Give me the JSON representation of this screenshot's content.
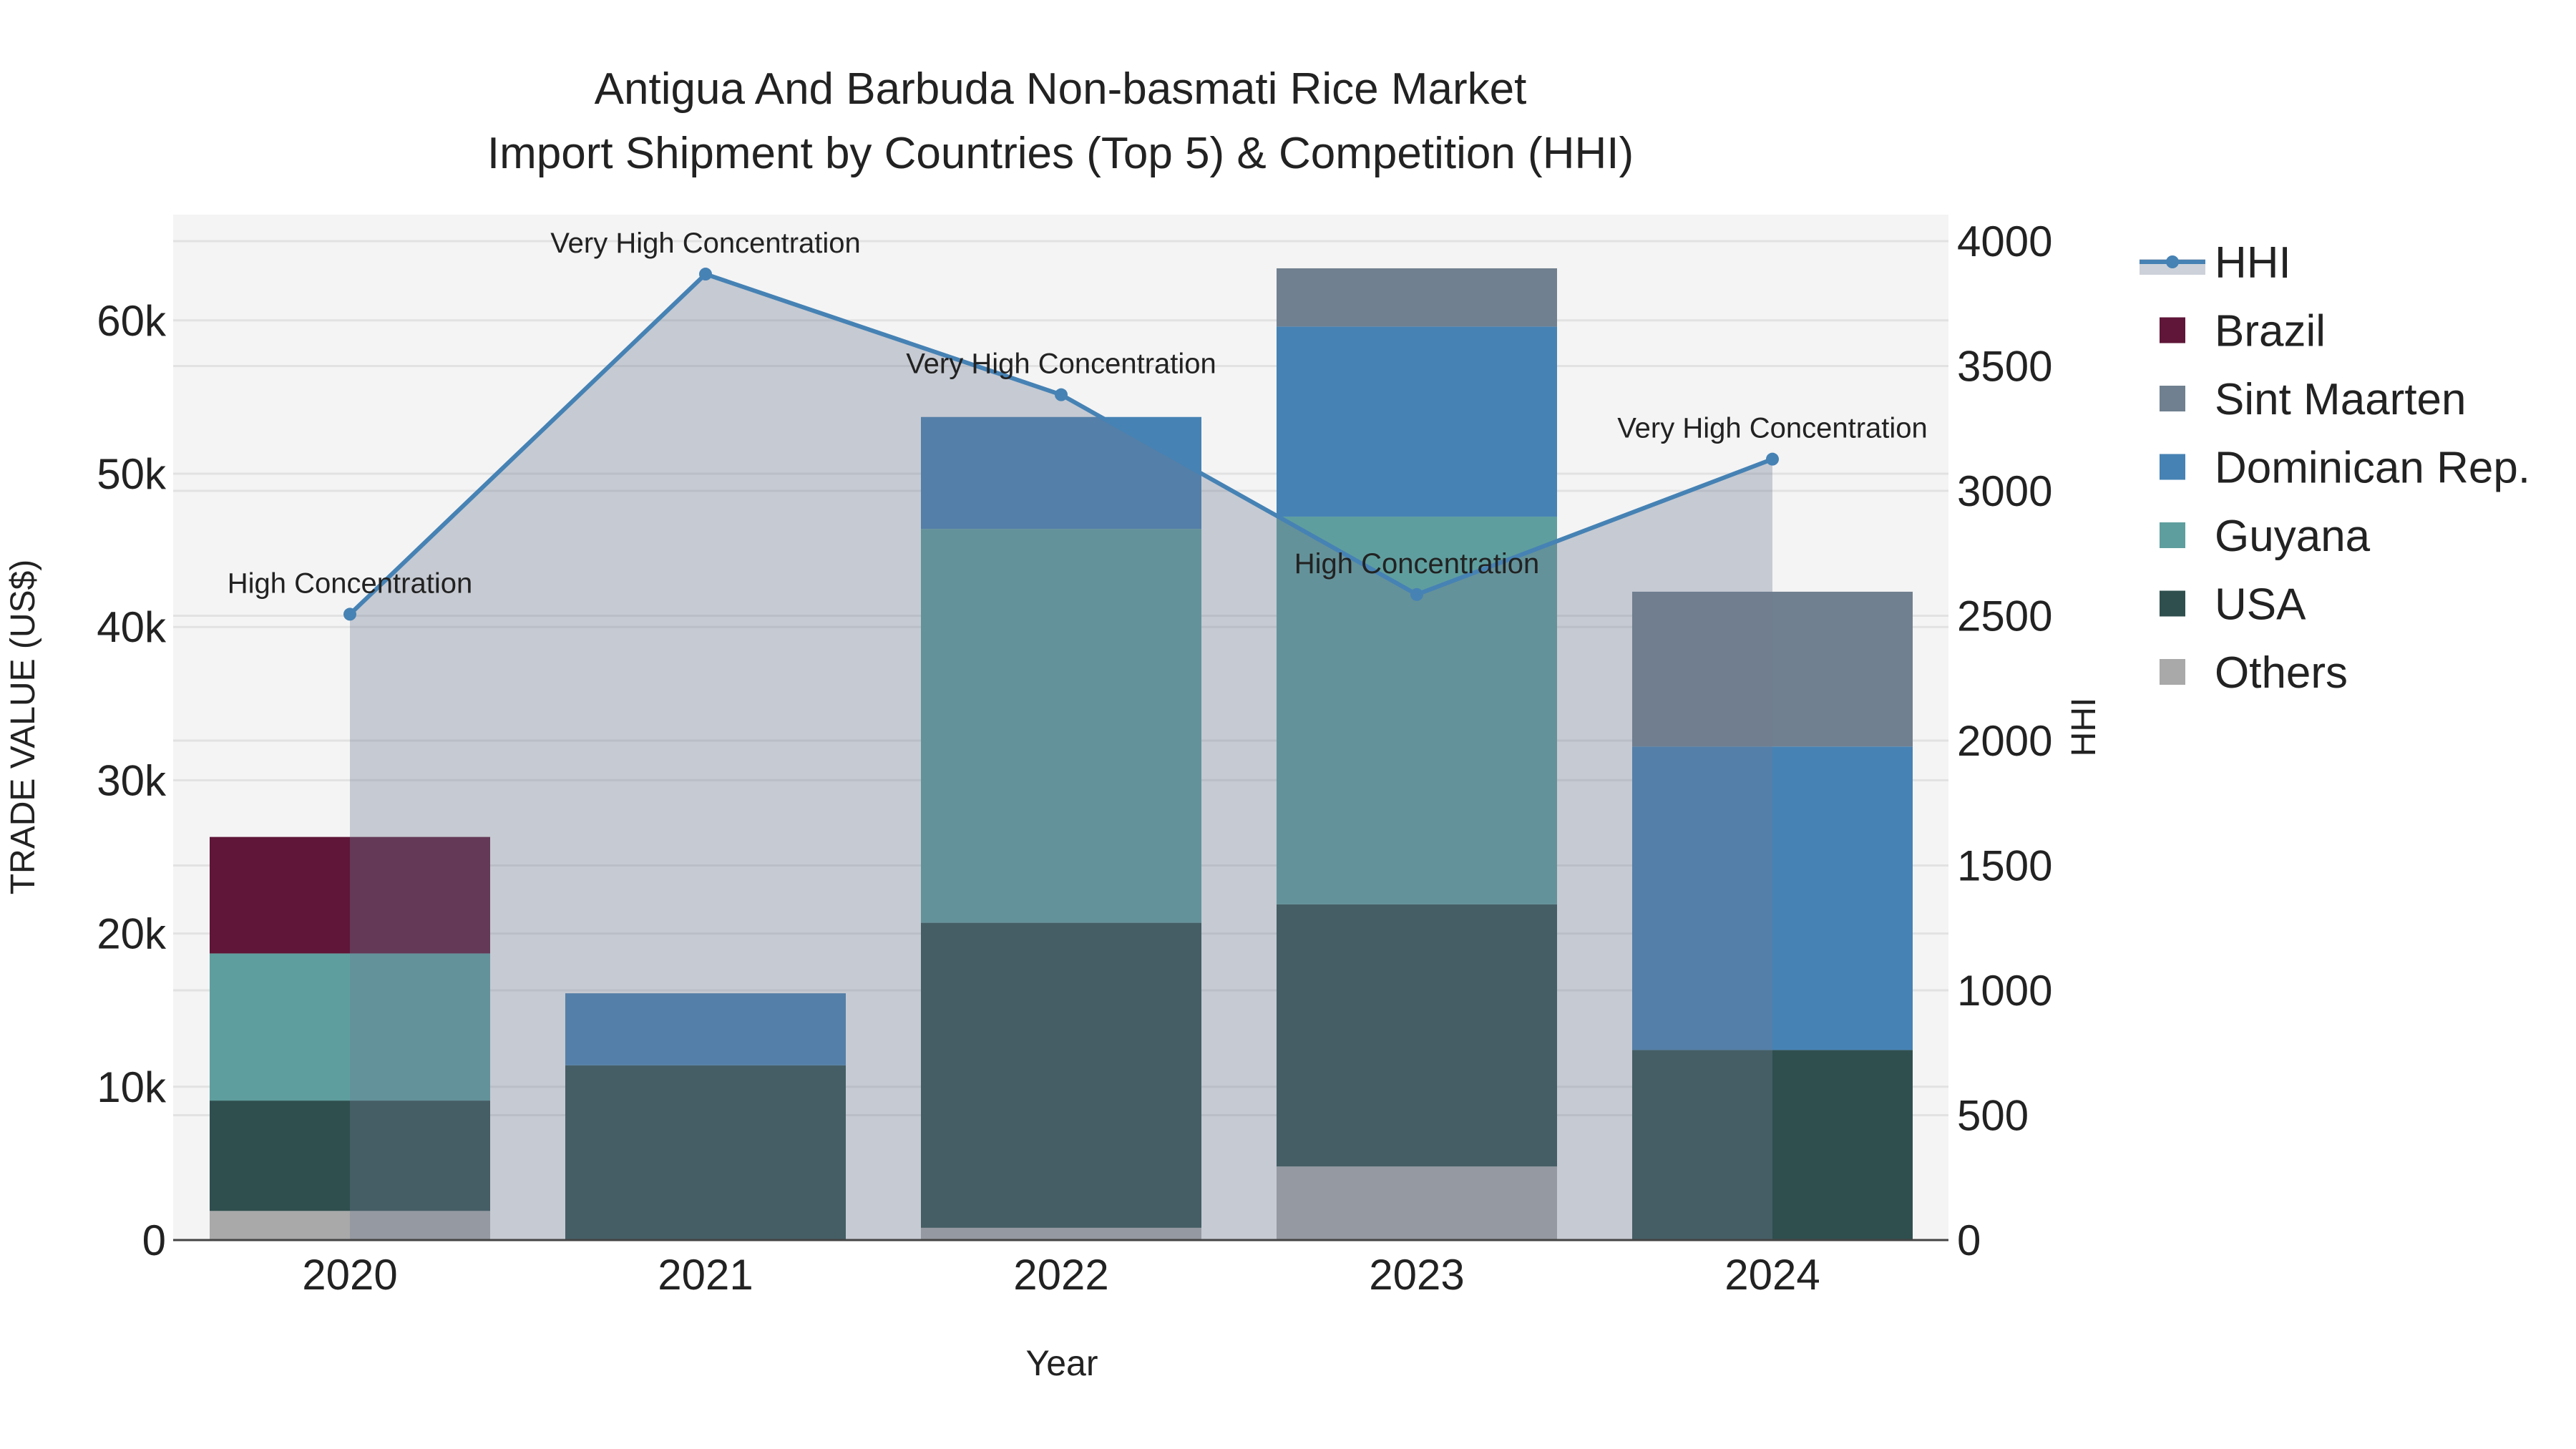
{
  "chart_data": {
    "type": "bar",
    "title_line1": "Antigua And Barbuda Non-basmati Rice Market",
    "title_line2": "Import Shipment by Countries (Top 5) & Competition (HHI)",
    "xlabel": "Year",
    "ylabel": "TRADE VALUE (US$)",
    "y2label": "HHI",
    "categories": [
      "2020",
      "2021",
      "2022",
      "2023",
      "2024"
    ],
    "ylim": [
      0,
      66900
    ],
    "y2lim": [
      0,
      4106
    ],
    "yticks": [
      0,
      10000,
      20000,
      30000,
      40000,
      50000,
      60000
    ],
    "ytick_labels": [
      "0",
      "10k",
      "20k",
      "30k",
      "40k",
      "50k",
      "60k"
    ],
    "y2ticks": [
      0,
      500,
      1000,
      1500,
      2000,
      2500,
      3000,
      3500,
      4000
    ],
    "y2tick_labels": [
      "0",
      "500",
      "1000",
      "1500",
      "2000",
      "2500",
      "3000",
      "3500",
      "4000"
    ],
    "series": [
      {
        "name": "Others",
        "color": "#a9a9a9",
        "values": [
          1900,
          0,
          800,
          4800,
          0
        ]
      },
      {
        "name": "USA",
        "color": "#2f4f4f",
        "values": [
          7200,
          11400,
          19900,
          17100,
          12400
        ]
      },
      {
        "name": "Guyana",
        "color": "#5f9e9e",
        "values": [
          9600,
          0,
          25700,
          25300,
          0
        ]
      },
      {
        "name": "Dominican Rep.",
        "color": "#4682b4",
        "values": [
          0,
          4700,
          7300,
          12400,
          19800
        ]
      },
      {
        "name": "Sint Maarten",
        "color": "#708090",
        "values": [
          0,
          0,
          0,
          3800,
          10100
        ]
      },
      {
        "name": "Brazil",
        "color": "#5f1638",
        "values": [
          7600,
          0,
          0,
          0,
          0
        ]
      }
    ],
    "hhi": {
      "name": "HHI",
      "color": "#4682b4",
      "values": [
        2506,
        3868,
        3385,
        2585,
        3127
      ],
      "annotations": [
        "High Concentration",
        "Very High Concentration",
        "Very High Concentration",
        "High Concentration",
        "Very High Concentration"
      ]
    },
    "legend": [
      "HHI",
      "Brazil",
      "Sint Maarten",
      "Dominican Rep.",
      "Guyana",
      "USA",
      "Others"
    ],
    "legend_position": "right",
    "grid": true
  }
}
